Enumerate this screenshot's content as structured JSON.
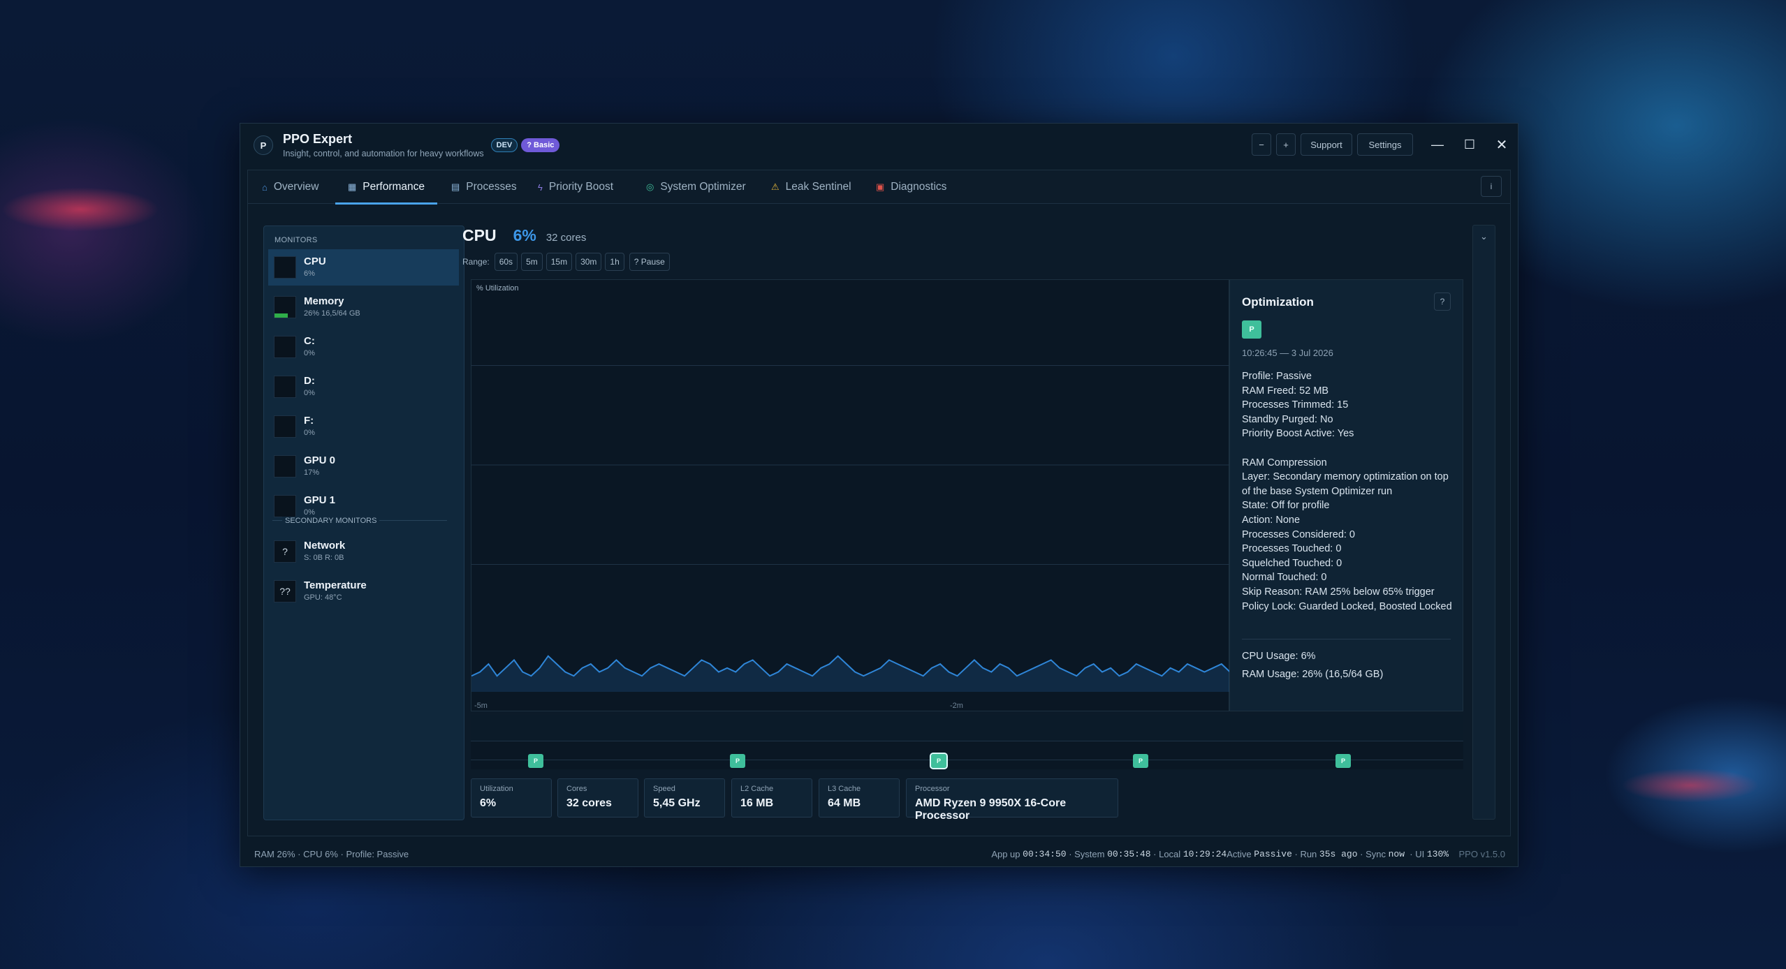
{
  "app": {
    "logo_letter": "P",
    "title": "PPO Expert",
    "subtitle": "Insight, control, and automation for heavy workflows",
    "badge_dev": "DEV",
    "badge_basic": "? Basic"
  },
  "titlebar": {
    "zoom_out": "−",
    "zoom_in": "+",
    "support": "Support",
    "settings": "Settings",
    "minimize": "—",
    "maximize": "☐",
    "close": "✕"
  },
  "tabs": [
    {
      "label": "Overview",
      "icon": "home-icon"
    },
    {
      "label": "Performance",
      "icon": "chart-icon"
    },
    {
      "label": "Processes",
      "icon": "document-icon"
    },
    {
      "label": "Priority Boost",
      "icon": "lightning-icon"
    },
    {
      "label": "System Optimizer",
      "icon": "gamepad-icon"
    },
    {
      "label": "Leak Sentinel",
      "icon": "warning-icon"
    },
    {
      "label": "Diagnostics",
      "icon": "toolbox-icon"
    }
  ],
  "info_button": "i",
  "sidebar": {
    "monitors_header": "MONITORS",
    "secondary_header": "SECONDARY MONITORS",
    "monitors": [
      {
        "name": "CPU",
        "value": "6%"
      },
      {
        "name": "Memory",
        "value": "26%  16,5/64 GB",
        "level": 0.26
      },
      {
        "name": "C:",
        "value": "0%"
      },
      {
        "name": "D:",
        "value": "0%"
      },
      {
        "name": "F:",
        "value": "0%"
      },
      {
        "name": "GPU 0",
        "value": "17%"
      },
      {
        "name": "GPU 1",
        "value": "0%"
      }
    ],
    "secondary": [
      {
        "name": "Network",
        "value": "S: 0B  R: 0B",
        "icon_text": "?"
      },
      {
        "name": "Temperature",
        "value": "GPU: 48°C",
        "icon_text": "??"
      }
    ]
  },
  "main": {
    "title": "CPU",
    "percent": "6%",
    "cores": "32 cores"
  },
  "range": {
    "label": "Range:",
    "options": [
      "60s",
      "5m",
      "15m",
      "30m",
      "1h"
    ],
    "pause": "? Pause"
  },
  "chart_data": {
    "type": "line",
    "ylabel": "% Utilization",
    "x_ticks": [
      "-5m",
      "-2m"
    ],
    "ylim": [
      0,
      100
    ],
    "grid": true,
    "color": "#2f86d8",
    "values": [
      4,
      5,
      7,
      4,
      6,
      8,
      5,
      4,
      6,
      9,
      7,
      5,
      4,
      6,
      7,
      5,
      6,
      8,
      6,
      5,
      4,
      6,
      7,
      6,
      5,
      4,
      6,
      8,
      7,
      5,
      6,
      5,
      7,
      8,
      6,
      4,
      5,
      7,
      6,
      5,
      4,
      6,
      7,
      9,
      7,
      5,
      4,
      5,
      6,
      8,
      7,
      6,
      5,
      4,
      6,
      7,
      5,
      4,
      6,
      8,
      6,
      5,
      7,
      6,
      4,
      5,
      6,
      7,
      8,
      6,
      5,
      4,
      6,
      7,
      5,
      6,
      4,
      5,
      7,
      6,
      5,
      4,
      6,
      5,
      7,
      6,
      5,
      6,
      7,
      5
    ]
  },
  "optimization": {
    "title": "Optimization",
    "help": "?",
    "badge": "P",
    "timestamp": "10:26:45 — 3 Jul 2026",
    "details": [
      "Profile: Passive",
      "RAM Freed: 52 MB",
      "Processes Trimmed: 15",
      "Standby Purged: No",
      "Priority Boost Active: Yes"
    ],
    "compression": [
      "RAM Compression",
      "Layer: Secondary memory optimization on top of the base System Optimizer run",
      "State: Off for profile",
      "Action: None",
      "Processes Considered: 0",
      "Processes Touched: 0",
      "Squelched Touched: 0",
      "Normal Touched: 0",
      "Skip Reason: RAM 25% below 65% trigger",
      "Policy Lock: Guarded Locked, Boosted Locked"
    ],
    "cpu_usage": "CPU Usage: 6%",
    "ram_usage": "RAM Usage: 26% (16,5/64 GB)"
  },
  "timeline_markers": [
    {
      "label": "P"
    },
    {
      "label": "P"
    },
    {
      "label": "P",
      "selected": true
    },
    {
      "label": "P"
    },
    {
      "label": "P"
    }
  ],
  "stats": [
    {
      "label": "Utilization",
      "value": "6%"
    },
    {
      "label": "Cores",
      "value": "32 cores"
    },
    {
      "label": "Speed",
      "value": "5,45 GHz"
    },
    {
      "label": "L2 Cache",
      "value": "16 MB"
    },
    {
      "label": "L3 Cache",
      "value": "64 MB"
    },
    {
      "label": "Processor",
      "value": "AMD Ryzen 9 9950X 16-Core Processor"
    }
  ],
  "status": {
    "left": "RAM 26%  ·  CPU 6%  ·  Profile: Passive",
    "app_up_label": "App up",
    "app_up": "00:34:50",
    "system_label": "· System",
    "system": "00:35:48",
    "local_label": "· Local",
    "local": "10:29:24",
    "active_label": "Active",
    "active": "Passive",
    "run_label": "· Run",
    "run": "35s ago",
    "sync_label": "· Sync",
    "sync": "now",
    "ui_label": "· UI",
    "ui": "130%",
    "version": "PPO v1.5.0"
  },
  "colors": {
    "accent": "#3d97e8",
    "brand_badge": "#6f5ad8",
    "marker": "#3fbf9b",
    "memory_bar": "#2fae4a"
  }
}
